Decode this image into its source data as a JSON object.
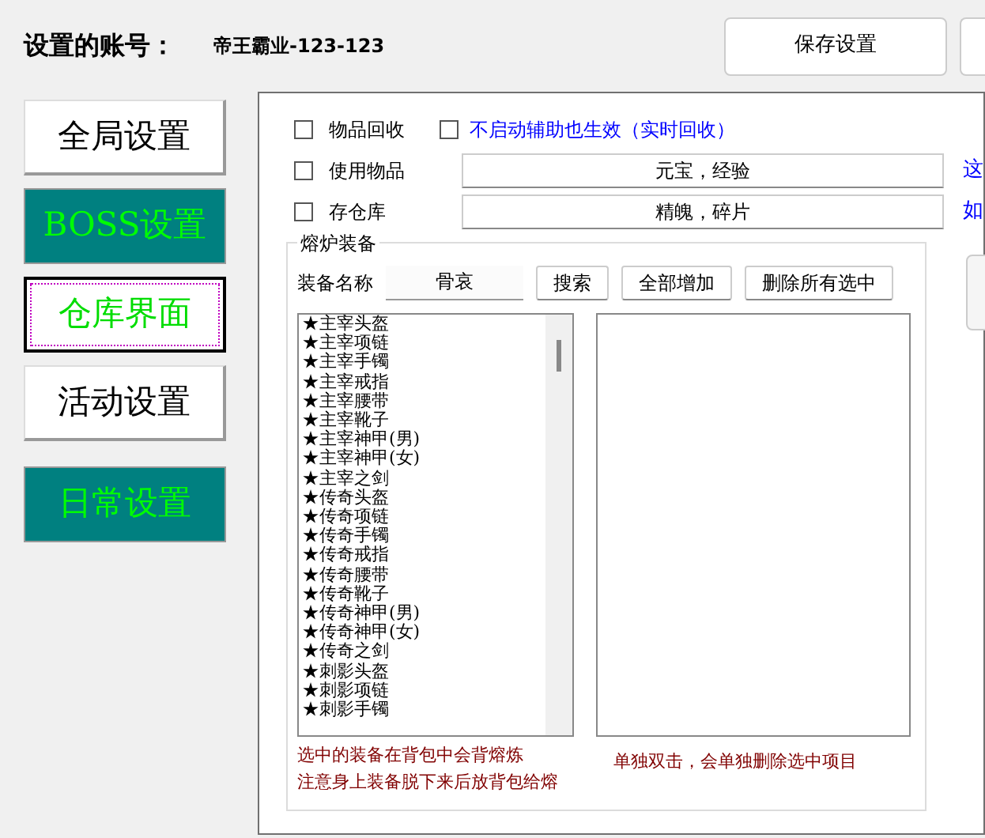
{
  "header": {
    "account_label": "设置的账号：",
    "account_value": "帝王霸业-123-123",
    "buttons": [
      "保存设置"
    ]
  },
  "nav": [
    {
      "label": "全局设置",
      "color": "#ffffff",
      "selected": false
    },
    {
      "label": "BOSS设置",
      "color": "#008080",
      "selected": false
    },
    {
      "label": "仓库界面",
      "color": "#ffffff",
      "selected": true
    },
    {
      "label": "活动设置",
      "color": "#ffffff",
      "selected": false
    },
    {
      "label": "日常设置",
      "color": "#008080",
      "selected": false
    }
  ],
  "options": [
    {
      "label": "物品回收",
      "checked": false,
      "extra_checkbox": {
        "label": "不启动辅助也生效（实时回收）",
        "checked": false
      }
    },
    {
      "label": "使用物品",
      "checked": false,
      "value": "元宝，经验",
      "note": "这"
    },
    {
      "label": "存仓库",
      "checked": false,
      "value": "精魄，碎片",
      "note": "如"
    }
  ],
  "furnace": {
    "title": "熔炉装备",
    "search_label": "装备名称",
    "search_value": "骨哀",
    "buttons": [
      "搜索",
      "全部增加",
      "删除所有选中"
    ],
    "items": [
      "★主宰头盔",
      "★主宰项链",
      "★主宰手镯",
      "★主宰戒指",
      "★主宰腰带",
      "★主宰靴子",
      "★主宰神甲(男)",
      "★主宰神甲(女)",
      "★主宰之剑",
      "★传奇头盔",
      "★传奇项链",
      "★传奇手镯",
      "★传奇戒指",
      "★传奇腰带",
      "★传奇靴子",
      "★传奇神甲(男)",
      "★传奇神甲(女)",
      "★传奇之剑",
      "★刺影头盔",
      "★刺影项链",
      "★刺影手镯"
    ],
    "left_notes": [
      "选中的装备在背包中会背熔炼",
      "注意身上装备脱下来后放背包给熔"
    ],
    "right_note": "单独双击，会单独删除选中项目"
  }
}
